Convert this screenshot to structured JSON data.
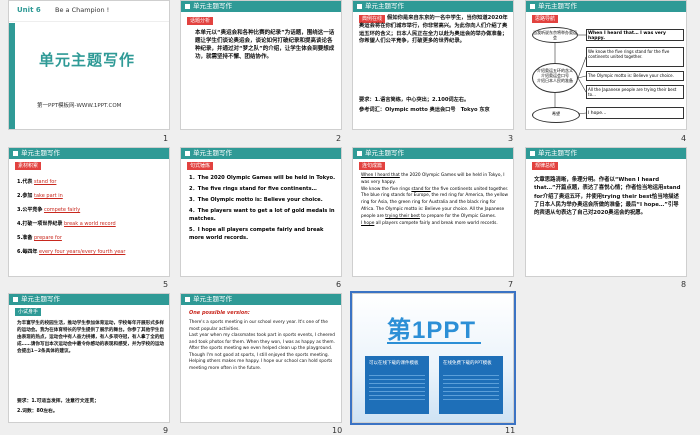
{
  "app_colors": {
    "accent": "#2f9a96",
    "selection": "#3b73c4",
    "pattern_red": "#e2423f"
  },
  "slide_numbers": [
    "1",
    "2",
    "3",
    "4",
    "5",
    "6",
    "7",
    "8",
    "9",
    "10",
    "11"
  ],
  "header_text": "单元主题写作",
  "s1": {
    "unit": "Unit 6",
    "unit_title": "Be a Champion !",
    "big_title": "单元主题写作",
    "footer": "第一PPT模板网-WWW.1PPT.COM"
  },
  "s2": {
    "tag": "话题分析",
    "body": "本单元以“奥运会和各种比赛的纪录”为话题，围绕这一话题让学生们谈论奥运会，谈论如何打破纪录和提高谈论各种纪录，并通过对“梦之队”的介绍，让学生体会到要想成功，就需坚持不懈、团结协作。"
  },
  "s3": {
    "tag": "典例在线",
    "body": "假如你是来自东京的一名中学生，当你知道2020年奥运会将在你们城市举行，你非常高兴。为此你向人们介绍了奥运五环的含义；日本人民正在全力以赴为奥运会的举办做准备；你希望人们公平竞争，打破更多的世界纪录。",
    "req": "要求：1.语言简练，中心突出；2.100词左右。",
    "words": "参考词汇：Olympic motto 奥运会口号　Tokyo 东京"
  },
  "s4": {
    "tag": "思路导航",
    "node_left1": "当我听说东京将举办奥运会",
    "node_left2": "介绍奥运五环的含义",
    "node_left3": "介绍奥运会口号",
    "node_left4": "介绍日本人民的准备",
    "node_left5": "希望",
    "box1": "When I heard that… I was very happy.",
    "box2": "We know the five rings stand for the five continents united together.",
    "box3": "The Olympic motto is: Believe your choice.",
    "box4": "All the Japanese people are trying their best to…",
    "box5": "I hope…"
  },
  "s5": {
    "tag": "素材积累",
    "items": [
      {
        "n": "1.代表",
        "v": "stand for"
      },
      {
        "n": "2.参加",
        "v": "take part in"
      },
      {
        "n": "3.公平竞争",
        "v": "compete fairly"
      },
      {
        "n": "4.打破一项世界纪录",
        "v": "break a world record"
      },
      {
        "n": "5.准备",
        "v": "prepare for"
      },
      {
        "n": "6.每四年",
        "v": "every four years/every fourth year"
      }
    ]
  },
  "s6": {
    "tag": "句式锤炼",
    "lines": [
      "1．The 2020 Olympic Games will be held in Tokyo.",
      "2．The five rings stand for five continents…",
      "3．The Olympic motto is: Believe your choice.",
      "4．The players want to get a lot of gold medals in matches.",
      "5．I hope all players compete fairly and break more world records."
    ]
  },
  "s7": {
    "tag": "连句成篇",
    "u1": "When I heard that",
    "p1": " the 2020 Olympic Games will be held in Tokyo, I was very happy.",
    "p2": "We know the five rings ",
    "u2": "stand for",
    "p3": " the five continents united together. The blue ring stands for Europe, the red ring for America, the yellow ring for Asia, the green ring for Australia and the black ring for Africa. The Olympic motto is: Believe your choice. All the Japanese people are ",
    "u3": "trying their best",
    "p4": " to prepare for the Olympic Games.",
    "u4": "I hope",
    "p5": " all players compete fairly and break more world records."
  },
  "s8": {
    "tag": "规律总结",
    "body": "文章思路清晰，条理分明。作者以“When I heard that…”开篇点题，表达了喜悦心情；作者恰当地运用stand for介绍了奥运五环，并使用trying their best恰当地描述了日本人民为举办奥运会所做的准备；最后“I hope…”引导的宾语从句表达了自己对2020奥运会的祝愿。"
  },
  "s9": {
    "tag": "小试身手",
    "body": "为丰富学生的校园生活，推动学生参加体育运动，学校每年开展形式多样的运动会。我为在体育特长的学生提供了展示的舞台。你参了其他学生自由表现的热点，运动会中有人奋力拼搏，有人多项夺冠，有人拿了全的组成……请你写出本次运动会中最令你感动的表现和感受，并为学校的运动会提出1~2条具体的建议。",
    "req": "要求：1.可适当发挥，注意行文连贯；",
    "words": "2.词数：80左右。"
  },
  "s10": {
    "tag": "One possible version:",
    "body": "There's a sports meeting in our school every year. It's one of the most popular activities.\nLast year when my classmates took part in sports events, I cheered and took photos for them. When they won, I was as happy as them. After the sports meeting we even helped clean up the playground.\nThough I'm not good at sports, I still enjoyed the sports meeting. Helping others makes me happy. I hope our school can hold sports meeting more often in the future."
  },
  "s11": {
    "logo_text": "第1PPT",
    "caption_left": "可以在线下载的课件模板",
    "caption_right": "在线免费下载的PPT模板"
  }
}
